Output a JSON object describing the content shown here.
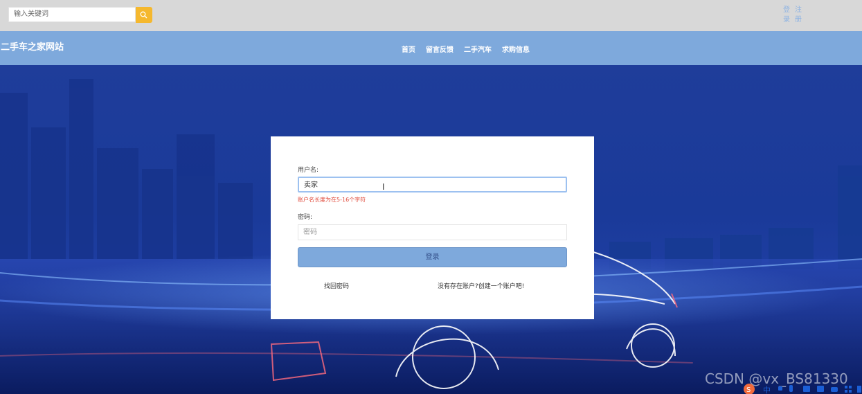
{
  "header": {
    "search_placeholder": "输入关键词",
    "login_label": [
      "登",
      "录"
    ],
    "register_label": [
      "注",
      "册"
    ]
  },
  "navbar": {
    "site_title": "二手车之家网站",
    "items": [
      "首页",
      "留言反馈",
      "二手汽车",
      "求购信息"
    ]
  },
  "login": {
    "username_label": "用户名:",
    "username_value": "卖家",
    "username_error": "账户名长度为在5-16个字符",
    "password_label": "密码:",
    "password_placeholder": "密码",
    "submit_label": "登录",
    "forgot_link": "找回密码",
    "create_link": "没有存在账户?创建一个账户吧!"
  },
  "watermark": "CSDN @vx_BS81330",
  "colors": {
    "topbar_bg": "#d8d8d8",
    "navbar_bg": "#7ea9dc",
    "search_button": "#f5b82e",
    "error_text": "#e0493a",
    "login_button": "#7ea9dc"
  },
  "icons": {
    "search_button": "search-icon",
    "text_cursor": "text-cursor-icon",
    "ime_toolbar": "sogou-ime-toolbar"
  }
}
